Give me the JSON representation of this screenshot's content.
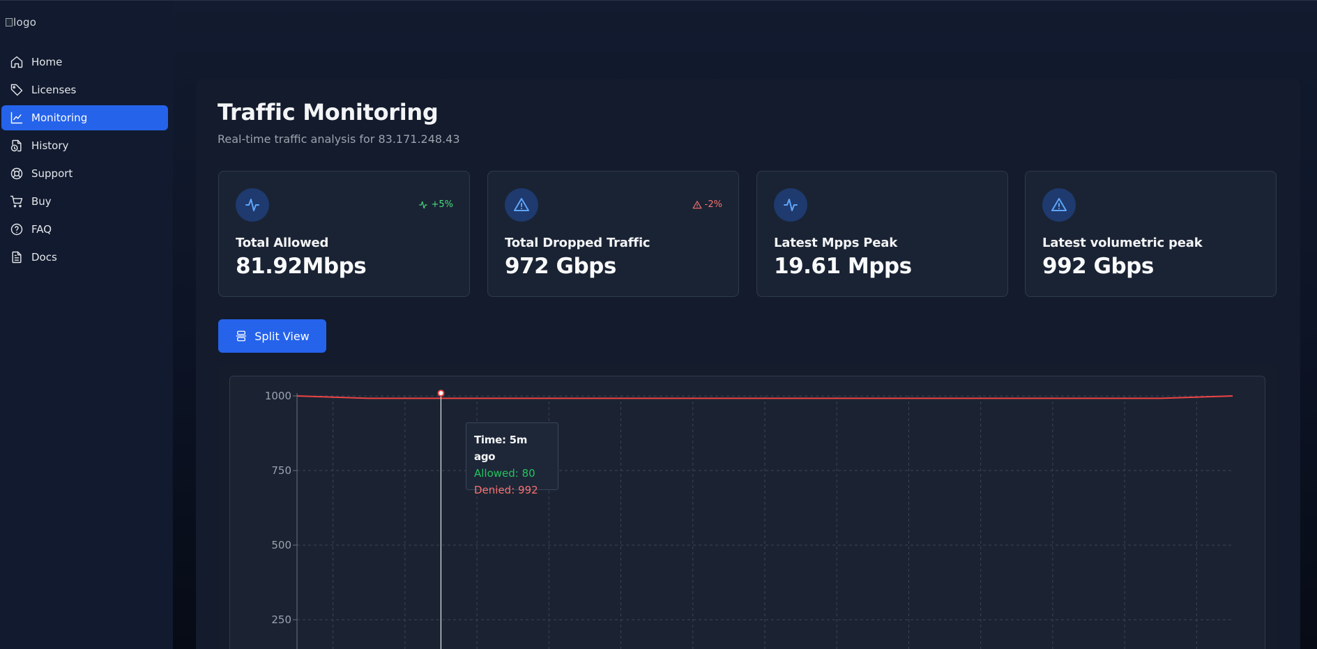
{
  "app": {
    "logo_alt": "logo"
  },
  "sidebar": {
    "items": [
      {
        "label": "Home",
        "icon": "home-icon",
        "active": false
      },
      {
        "label": "Licenses",
        "icon": "tag-icon",
        "active": false
      },
      {
        "label": "Monitoring",
        "icon": "line-chart-icon",
        "active": true
      },
      {
        "label": "History",
        "icon": "history-file-icon",
        "active": false
      },
      {
        "label": "Support",
        "icon": "lifebuoy-icon",
        "active": false
      },
      {
        "label": "Buy",
        "icon": "cart-icon",
        "active": false
      },
      {
        "label": "FAQ",
        "icon": "help-circle-icon",
        "active": false
      },
      {
        "label": "Docs",
        "icon": "document-icon",
        "active": false
      }
    ]
  },
  "page": {
    "title": "Traffic Monitoring",
    "subtitle": "Real-time traffic analysis for 83.171.248.43"
  },
  "stats": [
    {
      "label": "Total Allowed",
      "value": "81.92Mbps",
      "icon": "activity-icon",
      "badge": "+5%",
      "badge_type": "up"
    },
    {
      "label": "Total Dropped Traffic",
      "value": "972 Gbps",
      "icon": "alert-triangle-icon",
      "badge": "-2%",
      "badge_type": "down"
    },
    {
      "label": "Latest Mpps Peak",
      "value": "19.61 Mpps",
      "icon": "activity-icon",
      "badge": "",
      "badge_type": ""
    },
    {
      "label": "Latest volumetric peak",
      "value": "992 Gbps",
      "icon": "alert-triangle-icon",
      "badge": "",
      "badge_type": ""
    }
  ],
  "toolbar": {
    "split_view_label": "Split View",
    "split_view_icon": "split-view-icon"
  },
  "tooltip": {
    "time": "Time: 5m ago",
    "allowed": "Allowed: 80",
    "denied": "Denied: 992"
  },
  "colors": {
    "accent": "#2563eb",
    "allowed": "#22c55e",
    "denied": "#ef4444",
    "icon_blue": "#60a5fa"
  },
  "chart_data": {
    "type": "line",
    "yticks": [
      1000,
      750,
      500,
      250
    ],
    "ylim": [
      0,
      1000
    ],
    "grid": true,
    "x_points": 14,
    "series": [
      {
        "name": "Allowed",
        "values": [
          80,
          80,
          80,
          80,
          80,
          80,
          80,
          80,
          80,
          80,
          80,
          80,
          80,
          80
        ]
      },
      {
        "name": "Denied",
        "values": [
          1000,
          992,
          992,
          992,
          992,
          992,
          992,
          992,
          992,
          992,
          992,
          992,
          992,
          1000
        ]
      }
    ],
    "hover_index": 2
  }
}
